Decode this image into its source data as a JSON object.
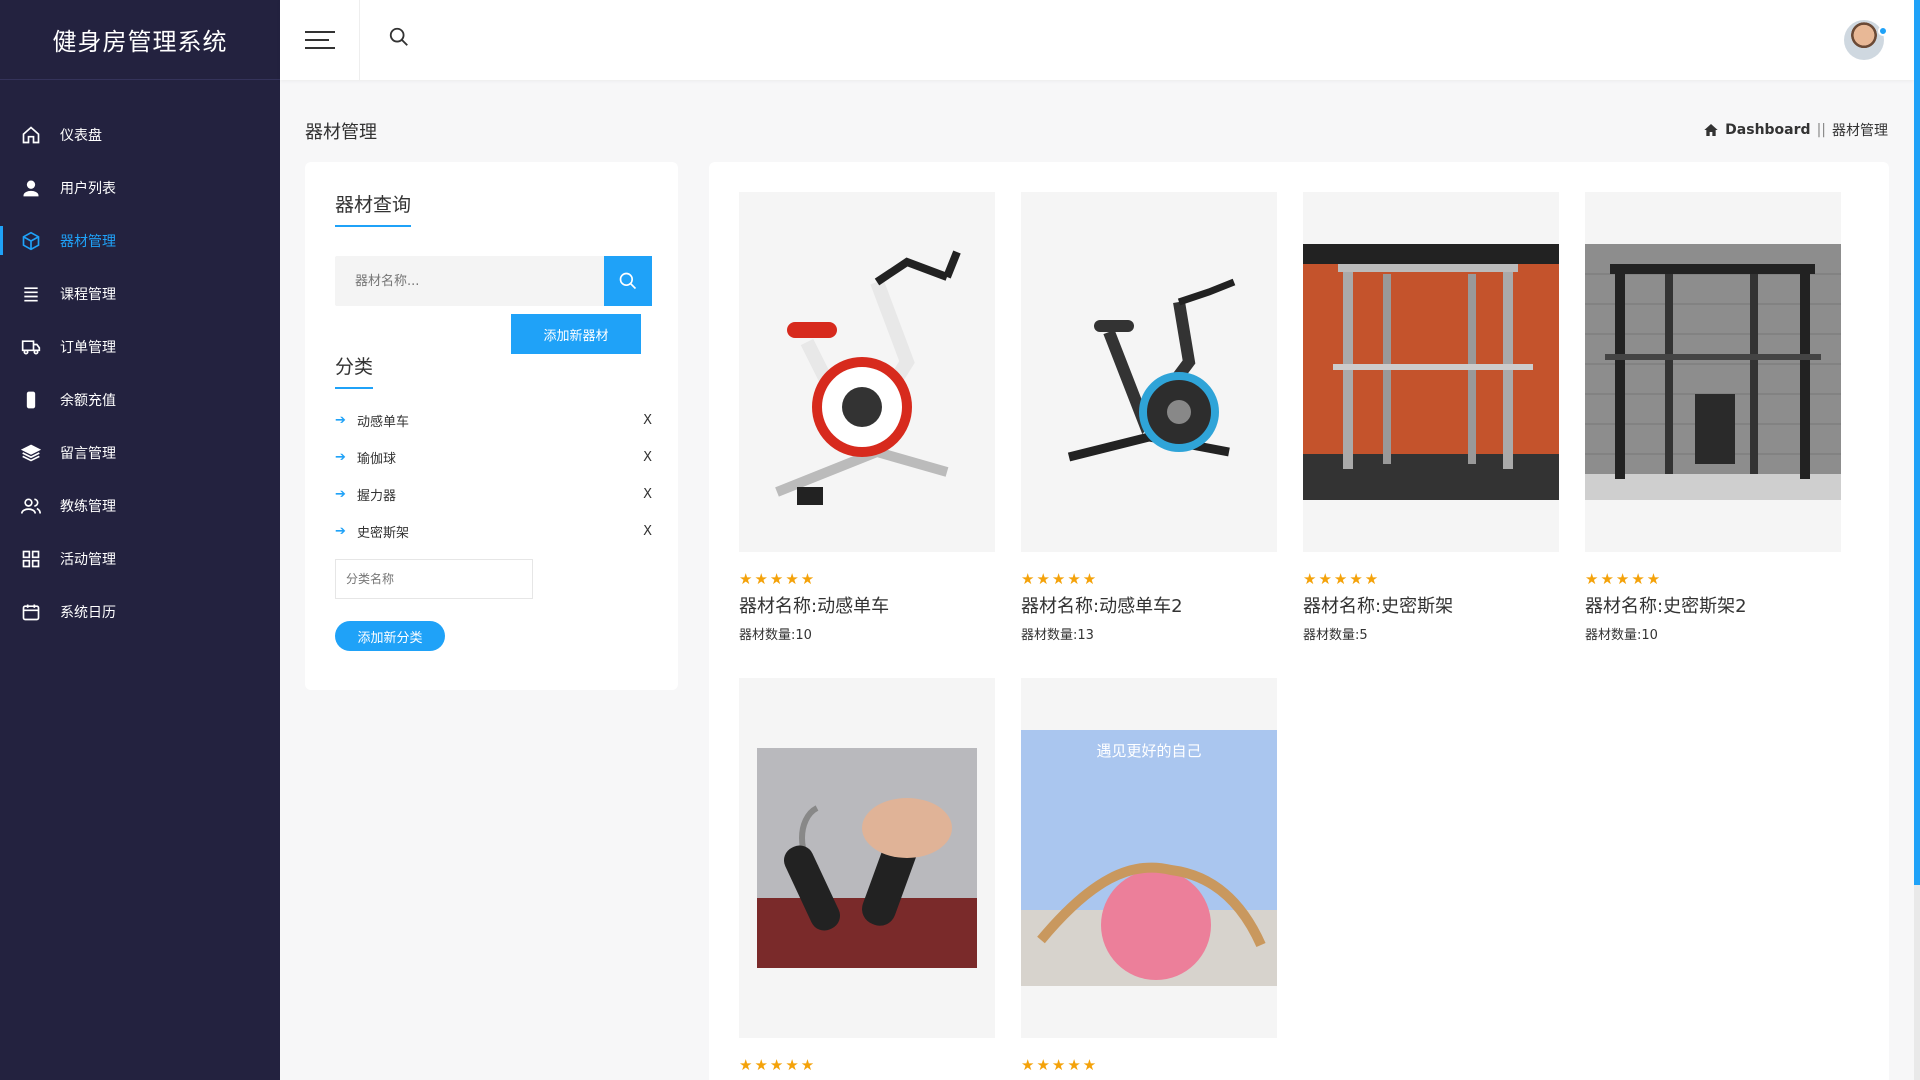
{
  "app": {
    "title": "健身房管理系统"
  },
  "sidebar": {
    "items": [
      {
        "label": "仪表盘",
        "icon": "home-icon"
      },
      {
        "label": "用户列表",
        "icon": "user-icon"
      },
      {
        "label": "器材管理",
        "icon": "box-icon",
        "active": true
      },
      {
        "label": "课程管理",
        "icon": "list-icon"
      },
      {
        "label": "订单管理",
        "icon": "truck-icon"
      },
      {
        "label": "余额充值",
        "icon": "phone-icon"
      },
      {
        "label": "留言管理",
        "icon": "layers-icon"
      },
      {
        "label": "教练管理",
        "icon": "users-icon"
      },
      {
        "label": "活动管理",
        "icon": "grid-icon"
      },
      {
        "label": "系统日历",
        "icon": "calendar-icon"
      }
    ]
  },
  "header": {
    "menu_icon": "hamburger-icon",
    "search_icon": "search-icon",
    "avatar": "avatar"
  },
  "page": {
    "title": "器材管理",
    "breadcrumb": {
      "home": "Dashboard",
      "separator": "||",
      "current": "器材管理"
    }
  },
  "query": {
    "title": "器材查询",
    "search_placeholder": "器材名称...",
    "add_equipment_label": "添加新器材"
  },
  "categories": {
    "title": "分类",
    "items": [
      {
        "name": "动感单车",
        "delete": "X"
      },
      {
        "name": "瑜伽球",
        "delete": "X"
      },
      {
        "name": "握力器",
        "delete": "X"
      },
      {
        "name": "史密斯架",
        "delete": "X"
      }
    ],
    "input_placeholder": "分类名称",
    "add_label": "添加新分类"
  },
  "equipment": [
    {
      "name": "器材名称:动感单车",
      "qty": "器材数量:10",
      "stars": "★★★★★",
      "image": "spin-bike-red"
    },
    {
      "name": "器材名称:动感单车2",
      "qty": "器材数量:13",
      "stars": "★★★★★",
      "image": "spin-bike-black"
    },
    {
      "name": "器材名称:史密斯架",
      "qty": "器材数量:5",
      "stars": "★★★★★",
      "image": "smith-rack-red-room"
    },
    {
      "name": "器材名称:史密斯架2",
      "qty": "器材数量:10",
      "stars": "★★★★★",
      "image": "smith-rack-brick"
    },
    {
      "name": "",
      "qty": "",
      "stars": "★★★★★",
      "image": "hand-grip"
    },
    {
      "name": "",
      "qty": "",
      "stars": "★★★★★",
      "image": "yoga-ball",
      "image_text": "遇见更好的自己"
    }
  ],
  "colors": {
    "accent": "#1fa2f8",
    "sidebar": "#23223f",
    "star": "#f4a20a"
  }
}
